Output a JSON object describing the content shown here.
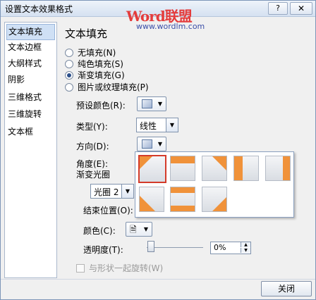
{
  "window": {
    "title": "设置文本效果格式",
    "help_label": "?",
    "close_glyph": "✕"
  },
  "watermark": {
    "brand": "Word联盟",
    "url": "www.wordlm.com"
  },
  "sidebar": {
    "items": [
      {
        "label": "文本填充",
        "active": true
      },
      {
        "label": "文本边框"
      },
      {
        "label": "大纲样式"
      },
      {
        "label": "阴影"
      },
      {
        "label": "三维格式"
      },
      {
        "label": "三维旋转"
      },
      {
        "label": "文本框"
      }
    ]
  },
  "main": {
    "section_title": "文本填充",
    "fill_options": [
      {
        "label": "无填充(N)",
        "selected": false
      },
      {
        "label": "纯色填充(S)",
        "selected": false
      },
      {
        "label": "渐变填充(G)",
        "selected": true
      },
      {
        "label": "图片或纹理填充(P)",
        "selected": false
      }
    ],
    "preset_colors_label": "预设颜色(R):",
    "type_label": "类型(Y):",
    "type_value": "线性",
    "direction_label": "方向(D):",
    "angle_label": "角度(E):",
    "gradient_stops_label": "渐变光圈",
    "stop_value": "光圈 2",
    "stop_position_label": "结束位置(O):",
    "color_label": "颜色(C):",
    "transparency_label": "透明度(T):",
    "transparency_value": "0%",
    "rotate_with_shape_label": "与形状一起旋转(W)"
  },
  "direction_presets": {
    "accent_color": "#f0923a",
    "selected_index": 0,
    "tiles": [
      {
        "name": "diagonal-top-left"
      },
      {
        "name": "linear-down"
      },
      {
        "name": "diagonal-top-right"
      },
      {
        "name": "linear-right"
      },
      {
        "name": "linear-left"
      },
      {
        "name": "linear-left-right-top"
      },
      {
        "name": "linear-up-top"
      },
      {
        "name": "diagonal-bottom-right"
      },
      {
        "name": "diagonal-bottom-left"
      }
    ]
  },
  "footer": {
    "close_label": "关闭"
  },
  "colors": {
    "selection_border": "#d43b2a",
    "active_nav_bg": "#cfe0f5"
  }
}
